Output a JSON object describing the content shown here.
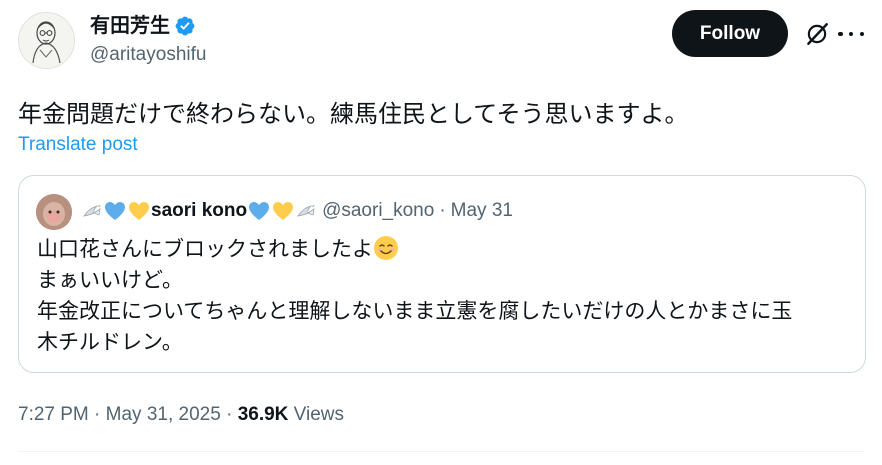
{
  "author": {
    "display_name": "有田芳生",
    "handle": "@aritayoshifu",
    "verified": true
  },
  "actions": {
    "follow_label": "Follow"
  },
  "post": {
    "text": "年金問題だけで終わらない。練馬住民としてそう思いますよ。",
    "translate_label": "Translate post"
  },
  "quoted": {
    "name": "saori kono",
    "handle": "@saori_kono",
    "separator": "·",
    "date": "May 31",
    "lines": [
      "山口花さんにブロックされましたよ",
      "まぁいいけど。",
      "年金改正についてちゃんと理解しないまま立憲を腐したいだけの人とかまさに玉",
      "木チルドレン。"
    ]
  },
  "meta": {
    "time": "7:27 PM",
    "separator": "·",
    "date": "May 31, 2025",
    "views_count": "36.9K",
    "views_label": "Views"
  },
  "colors": {
    "accent": "#1d9bf0",
    "text": "#0f1419",
    "muted": "#536471",
    "border": "#cfd9de"
  },
  "icons": [
    "verified-badge-icon",
    "grok-icon",
    "more-icon",
    "dove-emoji",
    "blue-heart-emoji",
    "yellow-heart-emoji",
    "smiling-face-emoji"
  ]
}
